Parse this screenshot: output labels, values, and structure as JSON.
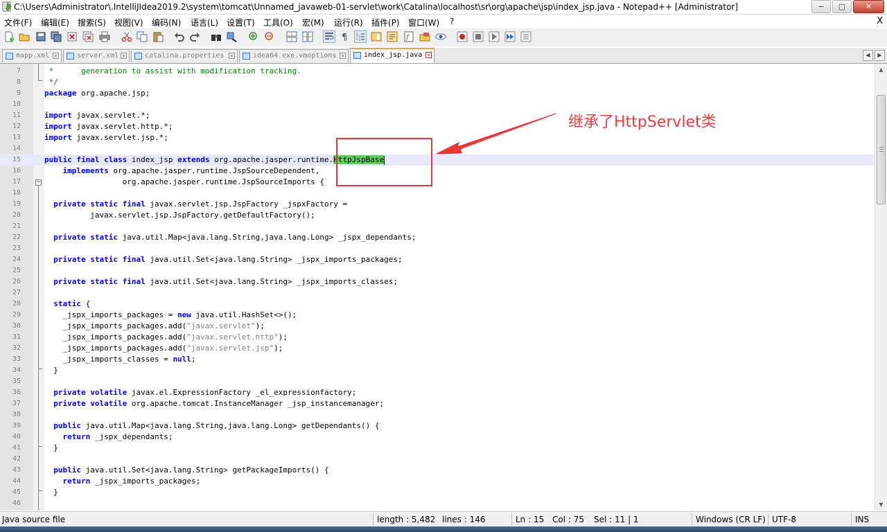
{
  "window": {
    "title": "C:\\Users\\Administrator\\.IntelliJIdea2019.2\\system\\tomcat\\Unnamed_javaweb-01-servlet\\work\\Catalina\\localhost\\sr\\org\\apache\\jsp\\index_jsp.java - Notepad++ [Administrator]",
    "minimize": "−",
    "maximize": "▢",
    "close": "✕"
  },
  "menu": {
    "items": [
      "文件(F)",
      "编辑(E)",
      "搜索(S)",
      "视图(V)",
      "编码(N)",
      "语言(L)",
      "设置(T)",
      "工具(O)",
      "宏(M)",
      "运行(R)",
      "插件(P)",
      "窗口(W)",
      "?"
    ],
    "close_symbol": "X"
  },
  "toolbar": {
    "icons": [
      "new-file-icon",
      "open-file-icon",
      "save-icon",
      "save-all-icon",
      "close-icon",
      "close-all-icon",
      "print-icon",
      "cut-icon",
      "copy-icon",
      "paste-icon",
      "undo-icon",
      "redo-icon",
      "find-icon",
      "replace-icon",
      "zoom-in-icon",
      "zoom-out-icon",
      "sync-vertical-icon",
      "sync-horizontal-icon",
      "word-wrap-icon",
      "show-all-chars-icon",
      "indent-guide-icon",
      "doc-map-icon",
      "function-list-icon",
      "folder-as-workspace-icon",
      "monitoring-icon",
      "record-macro-icon",
      "stop-record-icon",
      "playback-macro-icon",
      "run-macro-multiple-icon",
      "save-macro-icon"
    ]
  },
  "tabs": [
    {
      "label": "mapp.xml",
      "active": false
    },
    {
      "label": "server.xml",
      "active": false
    },
    {
      "label": "catalina.properties",
      "active": false
    },
    {
      "label": "idea64.exe.vmoptions",
      "active": false
    },
    {
      "label": "index_jsp.java",
      "active": true
    }
  ],
  "editor": {
    "lines": [
      {
        "n": "7",
        "text": " *      generation to assist with modification tracking."
      },
      {
        "n": "8",
        "text": " */"
      },
      {
        "n": "9",
        "text": "package org.apache.jsp;"
      },
      {
        "n": "10",
        "text": ""
      },
      {
        "n": "11",
        "text": "import javax.servlet.*;"
      },
      {
        "n": "12",
        "text": "import javax.servlet.http.*;"
      },
      {
        "n": "13",
        "text": "import javax.servlet.jsp.*;"
      },
      {
        "n": "14",
        "text": ""
      },
      {
        "n": "15",
        "text": "public final class index_jsp extends org.apache.jasper.runtime.HttpJspBase"
      },
      {
        "n": "16",
        "text": "    implements org.apache.jasper.runtime.JspSourceDependent,"
      },
      {
        "n": "17",
        "text": "                 org.apache.jasper.runtime.JspSourceImports {"
      },
      {
        "n": "18",
        "text": ""
      },
      {
        "n": "19",
        "text": "  private static final javax.servlet.jsp.JspFactory _jspxFactory ="
      },
      {
        "n": "20",
        "text": "          javax.servlet.jsp.JspFactory.getDefaultFactory();"
      },
      {
        "n": "21",
        "text": ""
      },
      {
        "n": "22",
        "text": "  private static java.util.Map<java.lang.String,java.lang.Long> _jspx_dependants;"
      },
      {
        "n": "23",
        "text": ""
      },
      {
        "n": "24",
        "text": "  private static final java.util.Set<java.lang.String> _jspx_imports_packages;"
      },
      {
        "n": "25",
        "text": ""
      },
      {
        "n": "26",
        "text": "  private static final java.util.Set<java.lang.String> _jspx_imports_classes;"
      },
      {
        "n": "27",
        "text": ""
      },
      {
        "n": "28",
        "text": "  static {"
      },
      {
        "n": "29",
        "text": "    _jspx_imports_packages = new java.util.HashSet<>();"
      },
      {
        "n": "30",
        "text": "    _jspx_imports_packages.add(\"javax.servlet\");"
      },
      {
        "n": "31",
        "text": "    _jspx_imports_packages.add(\"javax.servlet.http\");"
      },
      {
        "n": "32",
        "text": "    _jspx_imports_packages.add(\"javax.servlet.jsp\");"
      },
      {
        "n": "33",
        "text": "    _jspx_imports_classes = null;"
      },
      {
        "n": "34",
        "text": "  }"
      },
      {
        "n": "35",
        "text": ""
      },
      {
        "n": "36",
        "text": "  private volatile javax.el.ExpressionFactory _el_expressionfactory;"
      },
      {
        "n": "37",
        "text": "  private volatile org.apache.tomcat.InstanceManager _jsp_instancemanager;"
      },
      {
        "n": "38",
        "text": ""
      },
      {
        "n": "39",
        "text": "  public java.util.Map<java.lang.String,java.lang.Long> getDependants() {"
      },
      {
        "n": "40",
        "text": "    return _jspx_dependants;"
      },
      {
        "n": "41",
        "text": "  }"
      },
      {
        "n": "42",
        "text": ""
      },
      {
        "n": "43",
        "text": "  public java.util.Set<java.lang.String> getPackageImports() {"
      },
      {
        "n": "44",
        "text": "    return _jspx_imports_packages;"
      },
      {
        "n": "45",
        "text": "  }"
      },
      {
        "n": "46",
        "text": ""
      }
    ],
    "caret_line": "15",
    "selected_text": "HttpJspBase",
    "keywords": [
      "package",
      "import",
      "public",
      "final",
      "class",
      "extends",
      "implements",
      "private",
      "static",
      "new",
      "null",
      "volatile",
      "return"
    ]
  },
  "annotation": {
    "text": "继承了HttpServlet类",
    "color": "#f03c3c"
  },
  "status": {
    "file_type": "Java source file",
    "length": "length : 5,482",
    "lines": "lines : 146",
    "ln": "Ln : 15",
    "col": "Col : 75",
    "sel": "Sel : 11 | 1",
    "eol": "Windows (CR LF)",
    "encoding": "UTF-8",
    "mode": "INS"
  }
}
